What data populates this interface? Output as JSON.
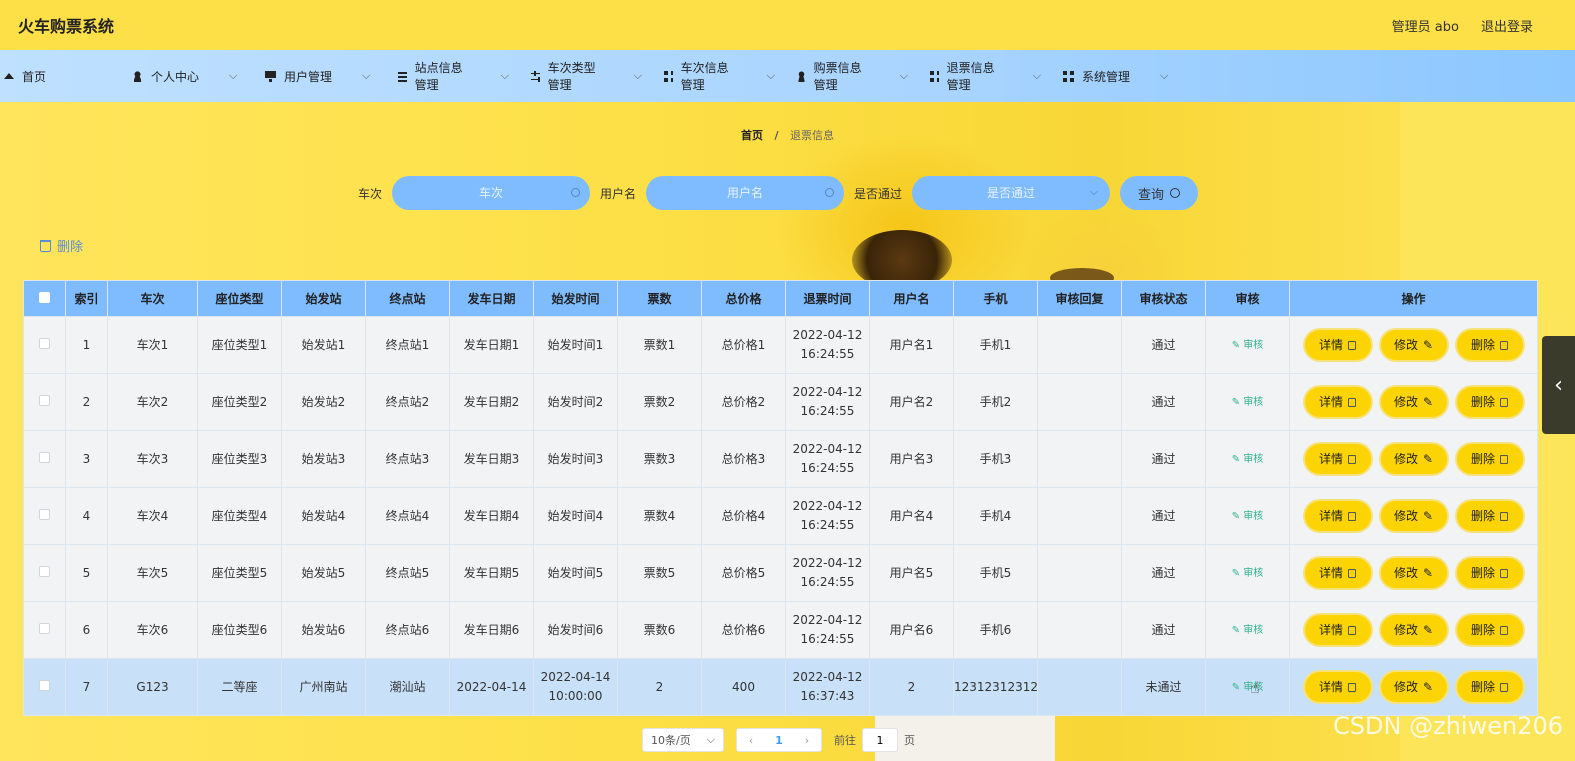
{
  "app": {
    "title": "火车购票系统"
  },
  "header": {
    "admin_label": "管理员 abo",
    "logout": "退出登录"
  },
  "nav": [
    {
      "label": "首页",
      "icon": "home-icon",
      "chev": false
    },
    {
      "label": "个人中心",
      "icon": "user-icon",
      "chev": true
    },
    {
      "label": "用户管理",
      "icon": "monitor-icon",
      "chev": true
    },
    {
      "label": "站点信息管理",
      "icon": "list-icon",
      "chev": true
    },
    {
      "label": "车次类型管理",
      "icon": "sliders-icon",
      "chev": true
    },
    {
      "label": "车次信息管理",
      "icon": "grid-icon",
      "chev": true
    },
    {
      "label": "购票信息管理",
      "icon": "user-icon",
      "chev": true
    },
    {
      "label": "退票信息管理",
      "icon": "grid-icon",
      "chev": true
    },
    {
      "label": "系统管理",
      "icon": "grid-icon",
      "chev": true
    }
  ],
  "breadcrumb": {
    "home": "首页",
    "sep": "/",
    "current": "退票信息"
  },
  "search": {
    "train_label": "车次",
    "train_placeholder": "车次",
    "user_label": "用户名",
    "user_placeholder": "用户名",
    "pass_label": "是否通过",
    "pass_placeholder": "是否通过",
    "query_label": "查询"
  },
  "bulk_delete": "删除",
  "table": {
    "headers": [
      "索引",
      "车次",
      "座位类型",
      "始发站",
      "终点站",
      "发车日期",
      "始发时间",
      "票数",
      "总价格",
      "退票时间",
      "用户名",
      "手机",
      "审核回复",
      "审核状态",
      "审核",
      "操作"
    ],
    "audit_link": "审核",
    "ops": {
      "detail": "详情",
      "edit": "修改",
      "delete": "删除"
    },
    "rows": [
      [
        "1",
        "车次1",
        "座位类型1",
        "始发站1",
        "终点站1",
        "发车日期1",
        "始发时间1",
        "票数1",
        "总价格1",
        "2022-04-12 16:24:55",
        "用户名1",
        "手机1",
        "",
        "通过"
      ],
      [
        "2",
        "车次2",
        "座位类型2",
        "始发站2",
        "终点站2",
        "发车日期2",
        "始发时间2",
        "票数2",
        "总价格2",
        "2022-04-12 16:24:55",
        "用户名2",
        "手机2",
        "",
        "通过"
      ],
      [
        "3",
        "车次3",
        "座位类型3",
        "始发站3",
        "终点站3",
        "发车日期3",
        "始发时间3",
        "票数3",
        "总价格3",
        "2022-04-12 16:24:55",
        "用户名3",
        "手机3",
        "",
        "通过"
      ],
      [
        "4",
        "车次4",
        "座位类型4",
        "始发站4",
        "终点站4",
        "发车日期4",
        "始发时间4",
        "票数4",
        "总价格4",
        "2022-04-12 16:24:55",
        "用户名4",
        "手机4",
        "",
        "通过"
      ],
      [
        "5",
        "车次5",
        "座位类型5",
        "始发站5",
        "终点站5",
        "发车日期5",
        "始发时间5",
        "票数5",
        "总价格5",
        "2022-04-12 16:24:55",
        "用户名5",
        "手机5",
        "",
        "通过"
      ],
      [
        "6",
        "车次6",
        "座位类型6",
        "始发站6",
        "终点站6",
        "发车日期6",
        "始发时间6",
        "票数6",
        "总价格6",
        "2022-04-12 16:24:55",
        "用户名6",
        "手机6",
        "",
        "通过"
      ],
      [
        "7",
        "G123",
        "二等座",
        "广州南站",
        "潮汕站",
        "2022-04-14",
        "2022-04-14 10:00:00",
        "2",
        "400",
        "2022-04-12 16:37:43",
        "2",
        "12312312312",
        "",
        "未通过"
      ]
    ]
  },
  "pager": {
    "size": "10条/页",
    "page": "1",
    "goto_prefix": "前往",
    "goto_value": "1",
    "goto_suffix": "页"
  },
  "watermark": "CSDN @zhiwen206",
  "colors": {
    "header": "#fde047",
    "nav": "#a8d4ff",
    "table_header": "#7fbcff",
    "op_button": "#fcd404",
    "audit": "#2fb38a"
  }
}
